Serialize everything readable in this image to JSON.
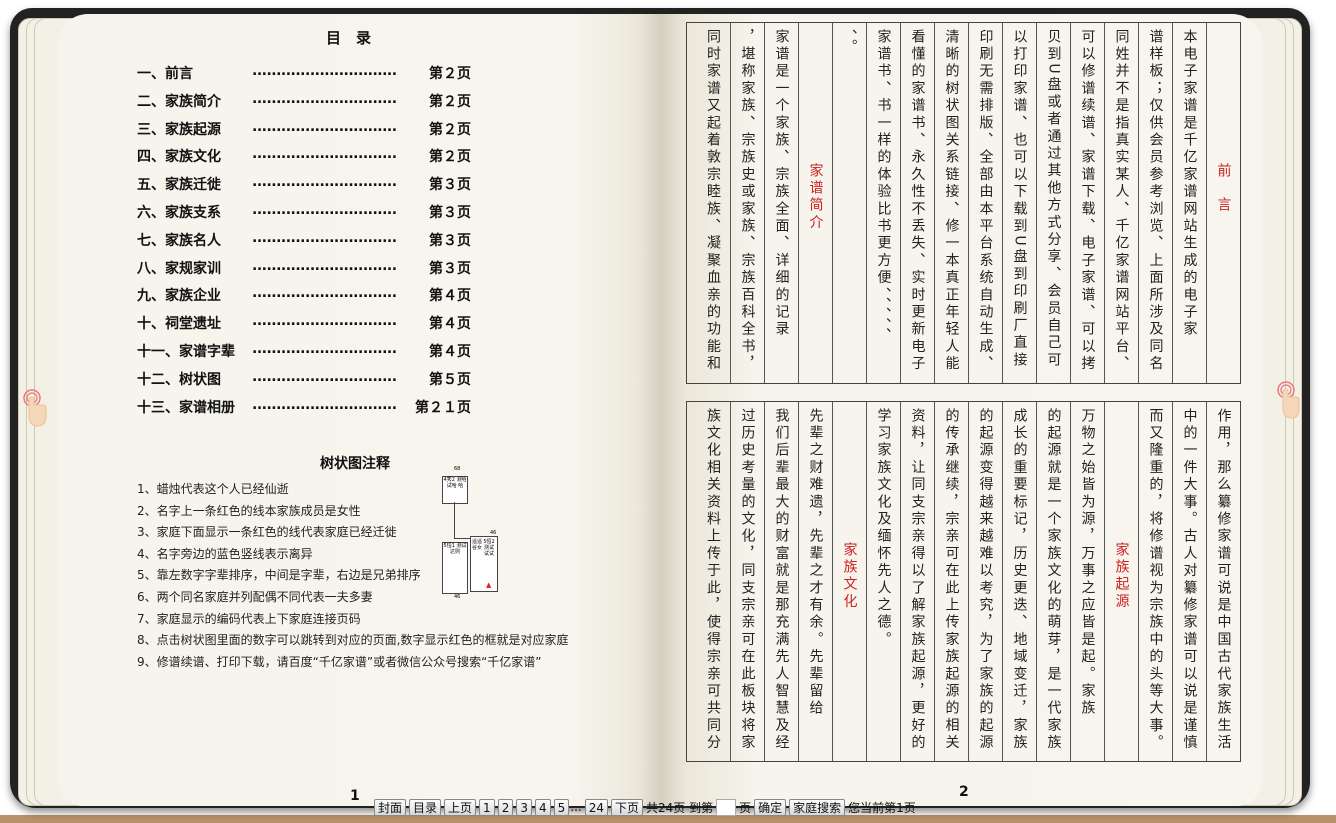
{
  "toc": {
    "title": "目　录",
    "dots": "..............................",
    "items": [
      {
        "name": "一、前言",
        "page": "第２页"
      },
      {
        "name": "二、家族简介",
        "page": "第２页"
      },
      {
        "name": "三、家族起源",
        "page": "第２页"
      },
      {
        "name": "四、家族文化",
        "page": "第２页"
      },
      {
        "name": "五、家族迁徙",
        "page": "第３页"
      },
      {
        "name": "六、家族支系",
        "page": "第３页"
      },
      {
        "name": "七、家族名人",
        "page": "第３页"
      },
      {
        "name": "八、家规家训",
        "page": "第３页"
      },
      {
        "name": "九、家族企业",
        "page": "第４页"
      },
      {
        "name": "十、祠堂遗址",
        "page": "第４页"
      },
      {
        "name": "十一、家谱字辈",
        "page": "第４页"
      },
      {
        "name": "十二、树状图",
        "page": "第５页"
      },
      {
        "name": "十三、家谱相册",
        "page": "第２１页"
      }
    ]
  },
  "notes": {
    "title": "树状图注释",
    "items": [
      "1、蜡烛代表这个人已经仙逝",
      "2、名字上一条红色的线本家族成员是女性",
      "3、家庭下面显示一条红色的线代表家庭已经迁徙",
      "4、名字旁边的蓝色竖线表示离异",
      "5、靠左数字字辈排序，中间是字辈，右边是兄弟排序",
      "6、两个同名家庭并列配偶不同代表一夫多妻",
      "7、家庭显示的编码代表上下家庭连接页码",
      "8、点击树状图里面的数字可以跳转到对应的页面,数字显示红色的框就是对应家庭",
      "9、修谱续谱、打印下载，请百度“千亿家谱”或者微信公众号搜索“千亿家谱”"
    ]
  },
  "tree_sample": {
    "top_code": "68",
    "top_box": "4秀2 测哈 试哈 哈",
    "left_box": "5恒1 测试 达则",
    "mid_box": "遥遥 谷女",
    "right_box": "5恒2 测试 试试",
    "side_code": "46",
    "bottom_code": "46"
  },
  "right_top_columns": [
    {
      "text": "前　言",
      "red": true
    },
    {
      "text": "本电子家谱是千亿家谱网站生成的电子家",
      "red": false
    },
    {
      "text": "谱样板；仅供会员参考浏览、上面所涉及同名",
      "red": false
    },
    {
      "text": "同姓并不是指真实某人、千亿家谱网站平台、",
      "red": false
    },
    {
      "text": "可以修谱续谱、家谱下载、电子家谱、可以拷",
      "red": false
    },
    {
      "text": "贝到U盘或者通过其他方式分享、会员自己可",
      "red": false
    },
    {
      "text": "以打印家谱、也可以下载到U盘到印刷厂直接",
      "red": false
    },
    {
      "text": "印刷无需排版、全部由本平台系统自动生成、",
      "red": false
    },
    {
      "text": "清晰的树状图关系链接、修一本真正年轻人能",
      "red": false
    },
    {
      "text": "看懂的家谱书、永久性不丢失、实时更新电子",
      "red": false
    },
    {
      "text": "家谱书、书一样的体验比书更方便、、、、、",
      "red": false
    },
    {
      "text": "、。",
      "red": false
    },
    {
      "text": "家谱简介",
      "red": true
    },
    {
      "text": "家谱是一个家族、宗族全面、详细的记录",
      "red": false
    },
    {
      "text": "，堪称家族、宗族史或家族、宗族百科全书，",
      "red": false
    },
    {
      "text": "同时家谱又起着敦宗睦族、凝聚血亲的功能和",
      "red": false
    }
  ],
  "right_bottom_columns": [
    {
      "text": "作用，那么纂修家谱可说是中国古代家族生活",
      "red": false
    },
    {
      "text": "中的一件大事。古人对纂修家谱可以说是谨慎",
      "red": false
    },
    {
      "text": "而又隆重的，将修谱视为宗族中的头等大事。",
      "red": false
    },
    {
      "text": "家族起源",
      "red": true
    },
    {
      "text": "万物之始皆为源，万事之应皆是起。家族",
      "red": false
    },
    {
      "text": "的起源就是一个家族文化的萌芽，是一代家族",
      "red": false
    },
    {
      "text": "成长的重要标记，历史更迭、地域变迁，家族",
      "red": false
    },
    {
      "text": "的起源变得越来越难以考究，为了家族的起源",
      "red": false
    },
    {
      "text": "的传承继续，宗亲可在此上传家族起源的相关",
      "red": false
    },
    {
      "text": "资料，让同支宗亲得以了解家族起源，更好的",
      "red": false
    },
    {
      "text": "学习家族文化及缅怀先人之德。",
      "red": false
    },
    {
      "text": "家族文化",
      "red": true
    },
    {
      "text": "先辈之财难遗，先辈之才有余。先辈留给",
      "red": false
    },
    {
      "text": "我们后辈最大的财富就是那充满先人智慧及经",
      "red": false
    },
    {
      "text": "过历史考量的文化，同支宗亲可在此板块将家",
      "red": false
    },
    {
      "text": "族文化相关资料上传于此，使得宗亲可共同分",
      "red": false
    }
  ],
  "page_numbers": {
    "left": "1",
    "right": "2"
  },
  "nav": {
    "cover": "封面",
    "toc": "目录",
    "prev": "上页",
    "pages": [
      "1",
      "2",
      "3",
      "4",
      "5"
    ],
    "ellipsis": "...",
    "last": "24",
    "next": "下页",
    "total_prefix": "共24页 到第",
    "page_suffix": "页",
    "confirm": "确定",
    "search": "家庭搜索",
    "current": "您当前第1页"
  }
}
